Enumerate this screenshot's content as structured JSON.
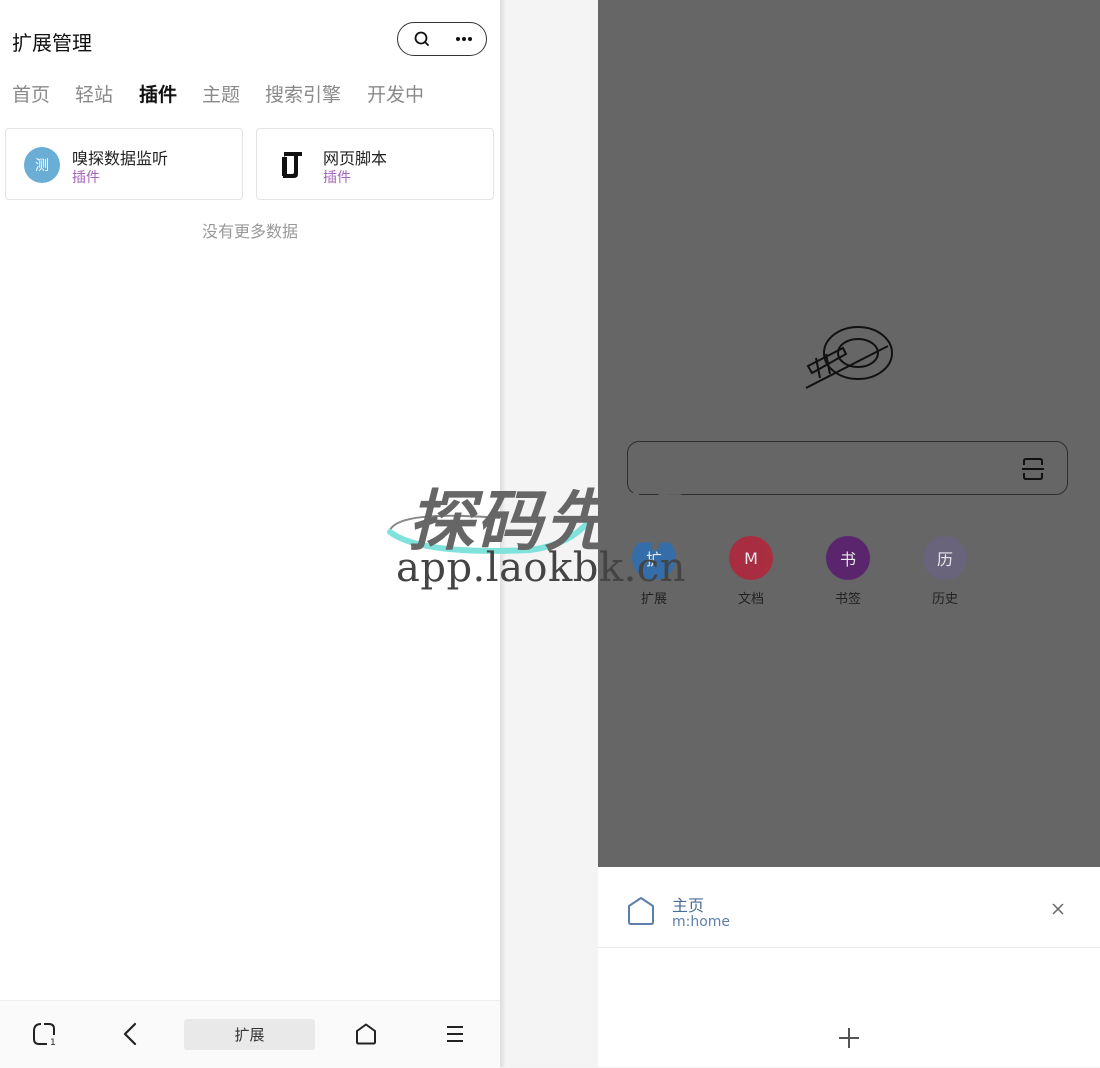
{
  "left": {
    "header": {
      "title": "扩展管理"
    },
    "tabs": [
      {
        "label": "首页",
        "active": false
      },
      {
        "label": "轻站",
        "active": false
      },
      {
        "label": "插件",
        "active": true
      },
      {
        "label": "主题",
        "active": false
      },
      {
        "label": "搜索引擎",
        "active": false
      },
      {
        "label": "开发中",
        "active": false
      }
    ],
    "cards": [
      {
        "avatar_text": "测",
        "name": "嗅探数据监听",
        "type": "插件",
        "icon": "avatar-circle",
        "avatar_color": "#6aaed6"
      },
      {
        "name": "网页脚本",
        "type": "插件",
        "icon": "script-logo-icon"
      }
    ],
    "empty_hint": "没有更多数据",
    "bottom_bar": {
      "center_label": "扩展",
      "tab_count": "1"
    }
  },
  "right": {
    "shortcuts": [
      {
        "letter": "扩",
        "label": "扩展",
        "color": "#2d6fb5"
      },
      {
        "letter": "M",
        "label": "文档",
        "color": "#b5243a"
      },
      {
        "letter": "书",
        "label": "书签",
        "color": "#5a1a70"
      },
      {
        "letter": "历",
        "label": "历史",
        "color": "#6a6380"
      }
    ],
    "tab_card": {
      "title": "主页",
      "url": "m:home"
    }
  },
  "watermark": {
    "title": "探码先锋",
    "url": "app.laokbk.cn"
  }
}
